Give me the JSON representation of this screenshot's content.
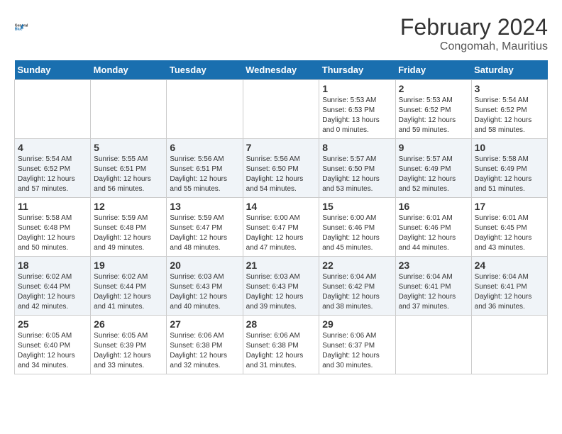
{
  "header": {
    "logo_line1": "General",
    "logo_line2": "Blue",
    "title": "February 2024",
    "subtitle": "Congomah, Mauritius"
  },
  "days_of_week": [
    "Sunday",
    "Monday",
    "Tuesday",
    "Wednesday",
    "Thursday",
    "Friday",
    "Saturday"
  ],
  "weeks": [
    [
      {
        "day": "",
        "info": ""
      },
      {
        "day": "",
        "info": ""
      },
      {
        "day": "",
        "info": ""
      },
      {
        "day": "",
        "info": ""
      },
      {
        "day": "1",
        "info": "Sunrise: 5:53 AM\nSunset: 6:53 PM\nDaylight: 13 hours\nand 0 minutes."
      },
      {
        "day": "2",
        "info": "Sunrise: 5:53 AM\nSunset: 6:52 PM\nDaylight: 12 hours\nand 59 minutes."
      },
      {
        "day": "3",
        "info": "Sunrise: 5:54 AM\nSunset: 6:52 PM\nDaylight: 12 hours\nand 58 minutes."
      }
    ],
    [
      {
        "day": "4",
        "info": "Sunrise: 5:54 AM\nSunset: 6:52 PM\nDaylight: 12 hours\nand 57 minutes."
      },
      {
        "day": "5",
        "info": "Sunrise: 5:55 AM\nSunset: 6:51 PM\nDaylight: 12 hours\nand 56 minutes."
      },
      {
        "day": "6",
        "info": "Sunrise: 5:56 AM\nSunset: 6:51 PM\nDaylight: 12 hours\nand 55 minutes."
      },
      {
        "day": "7",
        "info": "Sunrise: 5:56 AM\nSunset: 6:50 PM\nDaylight: 12 hours\nand 54 minutes."
      },
      {
        "day": "8",
        "info": "Sunrise: 5:57 AM\nSunset: 6:50 PM\nDaylight: 12 hours\nand 53 minutes."
      },
      {
        "day": "9",
        "info": "Sunrise: 5:57 AM\nSunset: 6:49 PM\nDaylight: 12 hours\nand 52 minutes."
      },
      {
        "day": "10",
        "info": "Sunrise: 5:58 AM\nSunset: 6:49 PM\nDaylight: 12 hours\nand 51 minutes."
      }
    ],
    [
      {
        "day": "11",
        "info": "Sunrise: 5:58 AM\nSunset: 6:48 PM\nDaylight: 12 hours\nand 50 minutes."
      },
      {
        "day": "12",
        "info": "Sunrise: 5:59 AM\nSunset: 6:48 PM\nDaylight: 12 hours\nand 49 minutes."
      },
      {
        "day": "13",
        "info": "Sunrise: 5:59 AM\nSunset: 6:47 PM\nDaylight: 12 hours\nand 48 minutes."
      },
      {
        "day": "14",
        "info": "Sunrise: 6:00 AM\nSunset: 6:47 PM\nDaylight: 12 hours\nand 47 minutes."
      },
      {
        "day": "15",
        "info": "Sunrise: 6:00 AM\nSunset: 6:46 PM\nDaylight: 12 hours\nand 45 minutes."
      },
      {
        "day": "16",
        "info": "Sunrise: 6:01 AM\nSunset: 6:46 PM\nDaylight: 12 hours\nand 44 minutes."
      },
      {
        "day": "17",
        "info": "Sunrise: 6:01 AM\nSunset: 6:45 PM\nDaylight: 12 hours\nand 43 minutes."
      }
    ],
    [
      {
        "day": "18",
        "info": "Sunrise: 6:02 AM\nSunset: 6:44 PM\nDaylight: 12 hours\nand 42 minutes."
      },
      {
        "day": "19",
        "info": "Sunrise: 6:02 AM\nSunset: 6:44 PM\nDaylight: 12 hours\nand 41 minutes."
      },
      {
        "day": "20",
        "info": "Sunrise: 6:03 AM\nSunset: 6:43 PM\nDaylight: 12 hours\nand 40 minutes."
      },
      {
        "day": "21",
        "info": "Sunrise: 6:03 AM\nSunset: 6:43 PM\nDaylight: 12 hours\nand 39 minutes."
      },
      {
        "day": "22",
        "info": "Sunrise: 6:04 AM\nSunset: 6:42 PM\nDaylight: 12 hours\nand 38 minutes."
      },
      {
        "day": "23",
        "info": "Sunrise: 6:04 AM\nSunset: 6:41 PM\nDaylight: 12 hours\nand 37 minutes."
      },
      {
        "day": "24",
        "info": "Sunrise: 6:04 AM\nSunset: 6:41 PM\nDaylight: 12 hours\nand 36 minutes."
      }
    ],
    [
      {
        "day": "25",
        "info": "Sunrise: 6:05 AM\nSunset: 6:40 PM\nDaylight: 12 hours\nand 34 minutes."
      },
      {
        "day": "26",
        "info": "Sunrise: 6:05 AM\nSunset: 6:39 PM\nDaylight: 12 hours\nand 33 minutes."
      },
      {
        "day": "27",
        "info": "Sunrise: 6:06 AM\nSunset: 6:38 PM\nDaylight: 12 hours\nand 32 minutes."
      },
      {
        "day": "28",
        "info": "Sunrise: 6:06 AM\nSunset: 6:38 PM\nDaylight: 12 hours\nand 31 minutes."
      },
      {
        "day": "29",
        "info": "Sunrise: 6:06 AM\nSunset: 6:37 PM\nDaylight: 12 hours\nand 30 minutes."
      },
      {
        "day": "",
        "info": ""
      },
      {
        "day": "",
        "info": ""
      }
    ]
  ]
}
